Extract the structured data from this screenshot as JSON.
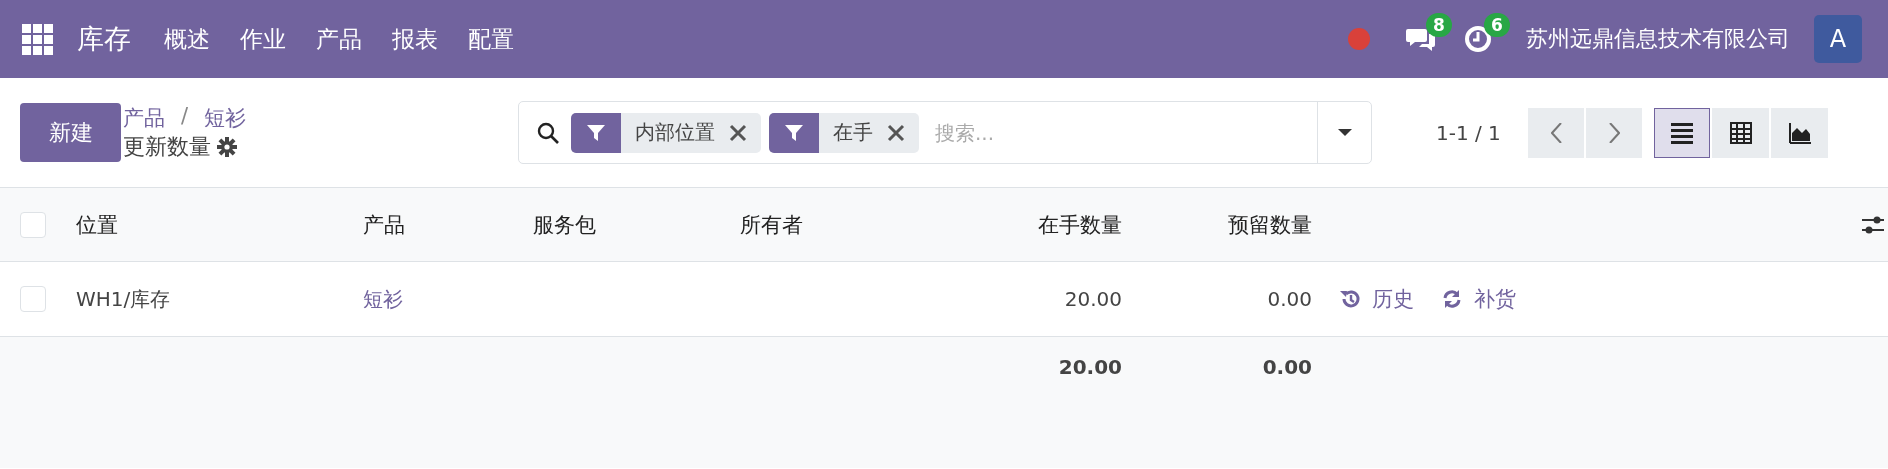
{
  "navbar": {
    "app": "库存",
    "menus": [
      "概述",
      "作业",
      "产品",
      "报表",
      "配置"
    ],
    "messages_count": "8",
    "activities_count": "6",
    "company": "苏州远鼎信息技术有限公司",
    "avatar": "A"
  },
  "control_panel": {
    "new_button": "新建",
    "breadcrumb": [
      "产品",
      "短衫"
    ],
    "breadcrumb_separator": "/",
    "title": "更新数量",
    "filters": [
      {
        "label": "内部位置"
      },
      {
        "label": "在手"
      }
    ],
    "search": {
      "placeholder": "搜索..."
    },
    "pager": "1-1 / 1",
    "views": [
      {
        "kind": "list",
        "selected": true
      },
      {
        "kind": "pivot",
        "selected": false
      },
      {
        "kind": "graph",
        "selected": false
      }
    ]
  },
  "table": {
    "select_all": {
      "checked": false
    },
    "columns": [
      {
        "label": "位置",
        "kind": "text"
      },
      {
        "label": "产品",
        "kind": "link"
      },
      {
        "label": "服务包",
        "kind": "text"
      },
      {
        "label": "所有者",
        "kind": "text"
      },
      {
        "label": "在手数量",
        "kind": "number"
      },
      {
        "label": "预留数量",
        "kind": "number"
      }
    ],
    "rows": [
      {
        "checked": false,
        "location": "WH1/库存",
        "product": "短衫",
        "on_hand": "20.00",
        "reserved": "0.00",
        "actions": [
          {
            "kind": "history",
            "label": "历史"
          },
          {
            "kind": "replenish",
            "label": "补货"
          }
        ]
      }
    ],
    "totals": {
      "on_hand": "20.00",
      "reserved": "0.00"
    }
  }
}
